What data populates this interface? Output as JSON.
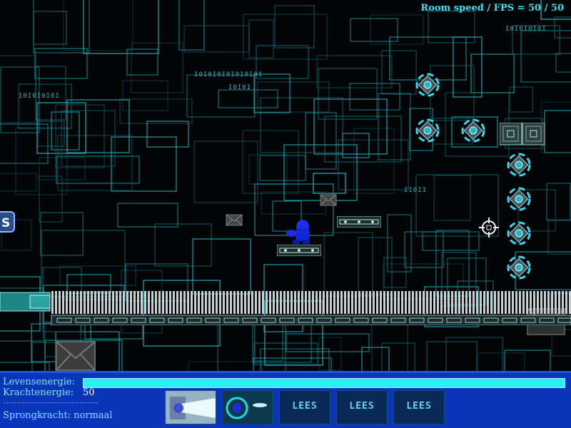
{
  "hud_top": {
    "fps_label": "Room speed / FPS = 50 / 50"
  },
  "binary_texts": [
    "I0I0I0I0I",
    "I0I0I0I0I0I0I0I",
    "I0I0I",
    "I0I0I0I0I",
    "I0I0I0I",
    "II0II"
  ],
  "status_panel": {
    "life_label": "Levensenergie:",
    "life_fraction": 1.0,
    "power_label": "Krachtenergie:",
    "power_value": "50",
    "separator": "-----------------------------------",
    "jump_label": "Sprongkracht: normaal"
  },
  "inventory": {
    "slots": [
      {
        "type": "laser-weapon",
        "label": ""
      },
      {
        "type": "orb-weapon",
        "label": ""
      },
      {
        "type": "empty",
        "label": "LEES"
      },
      {
        "type": "empty",
        "label": "LEES"
      },
      {
        "type": "empty",
        "label": "LEES"
      }
    ]
  },
  "colors": {
    "grid": "#1b8a96",
    "hud_bg": "#0b35b8",
    "energy_fill": "#2cf0f5",
    "hud_text": "#7fe9ff",
    "player": "#1226d8"
  }
}
